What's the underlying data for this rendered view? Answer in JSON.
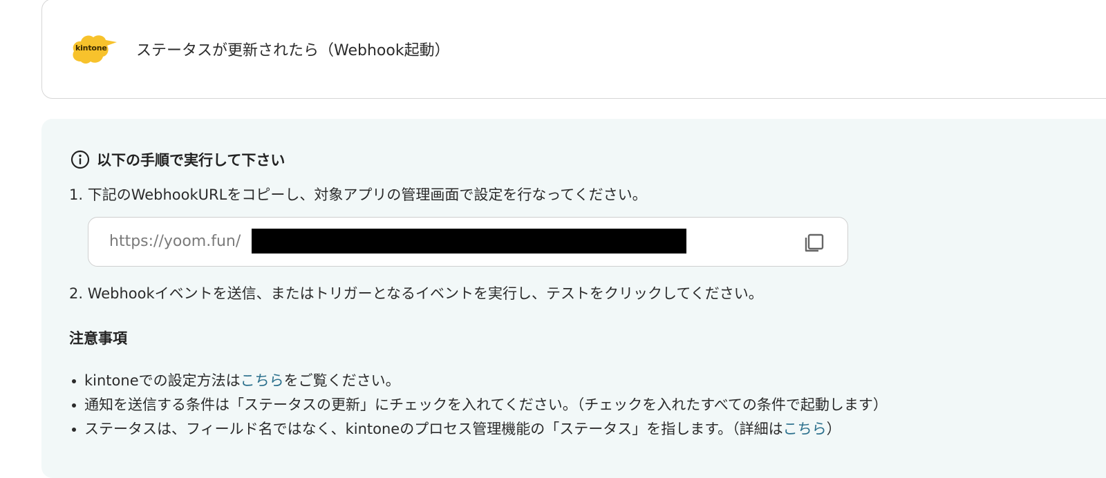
{
  "trigger": {
    "logo_text": "kintone",
    "title": "ステータスが更新されたら（Webhook起動）"
  },
  "instructions": {
    "heading": "以下の手順で実行して下さい",
    "step1": "1. 下記のWebhookURLをコピーし、対象アプリの管理画面で設定を行なってください。",
    "webhook_url_visible": "https://yoom.fun/",
    "step2": "2. Webhookイベントを送信、またはトリガーとなるイベントを実行し、テストをクリックしてください。"
  },
  "notes": {
    "heading": "注意事項",
    "item1": {
      "before": "kintoneでの設定方法は",
      "link": "こちら",
      "after": "をご覧ください。"
    },
    "item2": {
      "text": "通知を送信する条件は「ステータスの更新」にチェックを入れてください。（チェックを入れたすべての条件で起動します）"
    },
    "item3": {
      "before": "ステータスは、フィールド名ではなく、kintoneのプロセス管理機能の「ステータス」を指します。（詳細は",
      "link": "こちら",
      "after": "）"
    }
  },
  "icons": {
    "info": "info-circle-icon",
    "copy": "copy-icon",
    "logo": "kintone-logo"
  },
  "colors": {
    "panel_background": "#f2f8f8",
    "link": "#2a6f8c",
    "logo_yellow": "#f7c22c"
  }
}
